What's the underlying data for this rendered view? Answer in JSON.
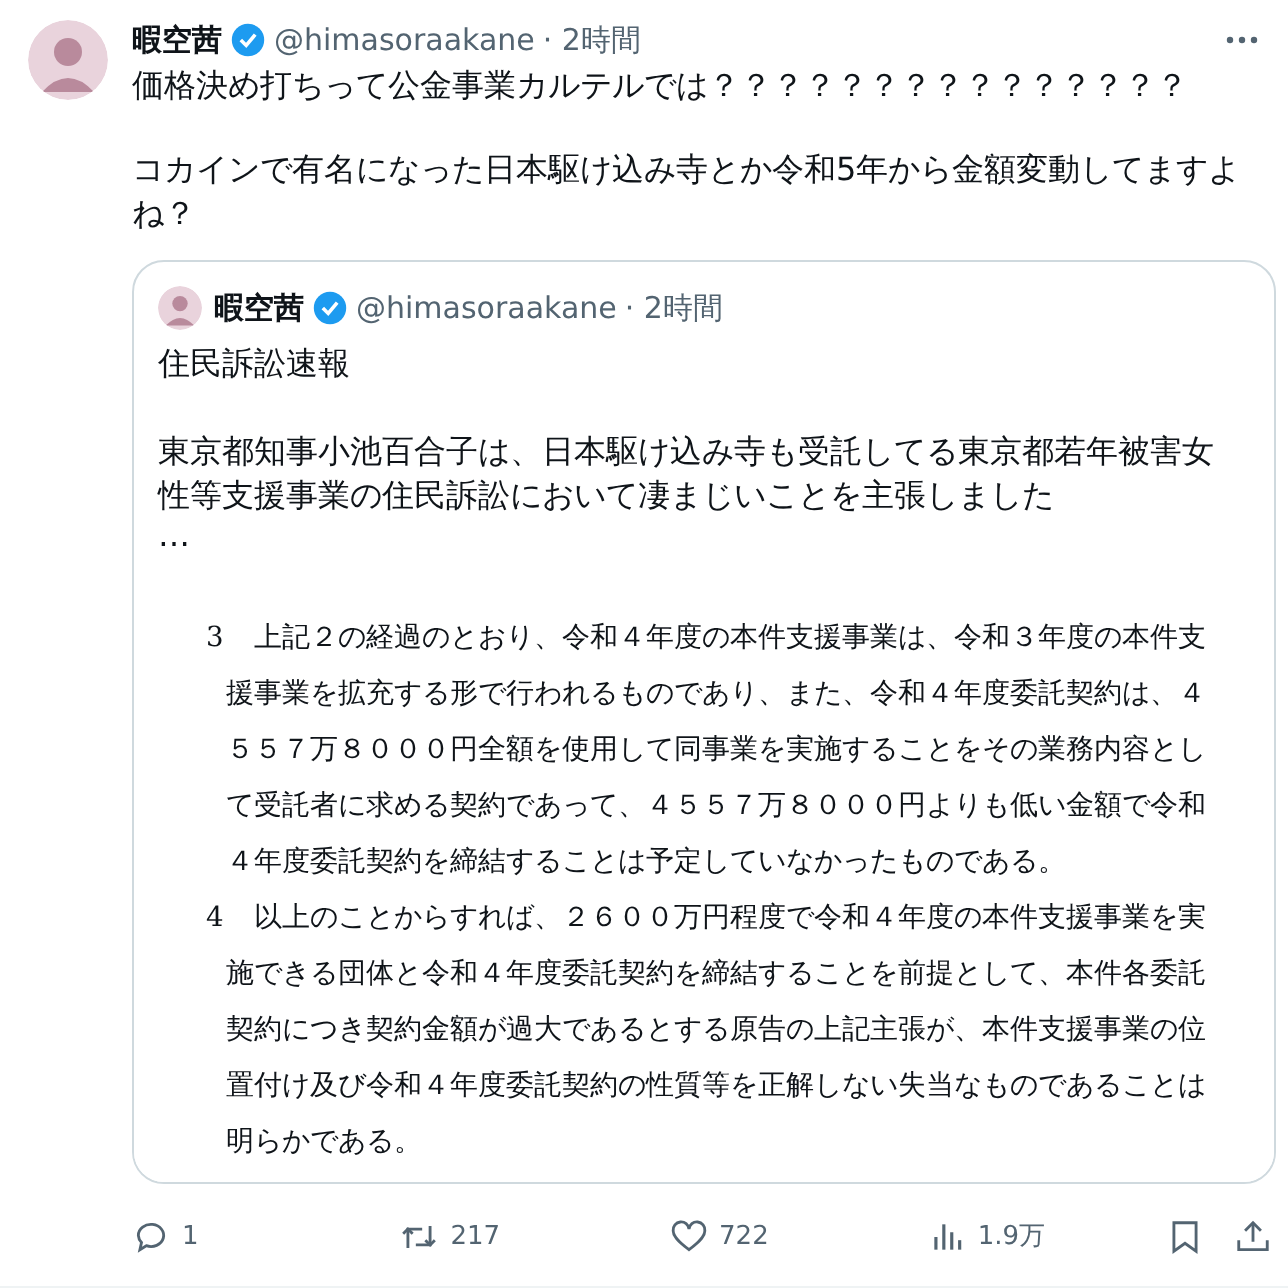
{
  "post": {
    "name": "暇空茜",
    "handle": "@himasoraakane",
    "time": "· 2時間",
    "paragraphs": [
      "価格決め打ちって公金事業カルテルでは？？？？？？？？？？？？？？？",
      "コカインで有名になった日本駆け込み寺とか令和5年から金額変動してますよね？"
    ]
  },
  "quote": {
    "name": "暇空茜",
    "handle": "@himasoraakane",
    "time": "· 2時間",
    "paragraphs": [
      "住民訴訟速報",
      "東京都知事小池百合子は、日本駆け込み寺も受託してる東京都若年被害女性等支援事業の住民訴訟において凄まじいことを主張しました"
    ],
    "more": "…",
    "document": [
      {
        "number": "3",
        "lines": [
          "上記２の経過のとおり、令和４年度の本件支援事業は、令和３年度の本件支",
          "援事業を拡充する形で行われるものであり、また、令和４年度委託契約は、４",
          "５５７万８０００円全額を使用して同事業を実施することをその業務内容とし",
          "て受託者に求める契約であって、４５５７万８０００円よりも低い金額で令和",
          "４年度委託契約を締結することは予定していなかったものである。"
        ]
      },
      {
        "number": "4",
        "lines": [
          "以上のことからすれば、２６００万円程度で令和４年度の本件支援事業を実",
          "施できる団体と令和４年度委託契約を締結することを前提として、本件各委託",
          "契約につき契約金額が過大であるとする原告の上記主張が、本件支援事業の位",
          "置付け及び令和４年度委託契約の性質等を正解しない失当なものであることは",
          "明らかである。"
        ]
      }
    ]
  },
  "actions": [
    {
      "kind": "reply",
      "count": "1"
    },
    {
      "kind": "repost",
      "count": "217"
    },
    {
      "kind": "like",
      "count": "722"
    },
    {
      "kind": "views",
      "count": "1.9万"
    },
    {
      "kind": "bookmark"
    },
    {
      "kind": "share"
    }
  ]
}
